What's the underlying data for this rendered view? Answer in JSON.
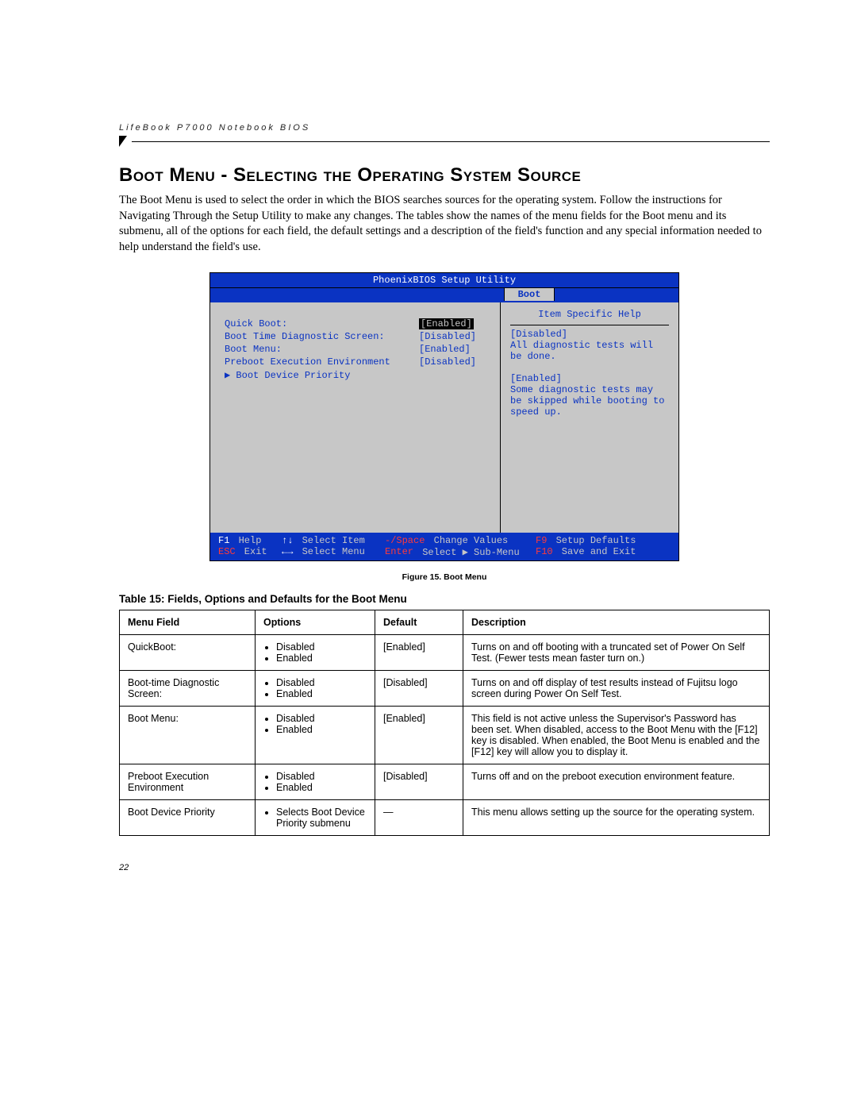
{
  "running_head": "LifeBook P7000 Notebook BIOS",
  "section_title": "Boot Menu - Selecting the Operating System Source",
  "intro_text": "The Boot Menu is used to select the order in which the BIOS searches sources for the operating system. Follow the instructions for Navigating Through the Setup Utility to make any changes. The tables show the names of the menu fields for the Boot menu and its submenu, all of the options for each field, the default settings and a description of the field's function and any special information needed to help understand the field's use.",
  "bios": {
    "utility_title": "PhoenixBIOS Setup Utility",
    "active_tab": "Boot",
    "items": [
      {
        "label": "Quick Boot:",
        "value": "[Enabled]",
        "selected": true
      },
      {
        "label": "Boot Time Diagnostic Screen:",
        "value": "[Disabled]",
        "selected": false
      },
      {
        "label": "Boot Menu:",
        "value": "[Enabled]",
        "selected": false
      },
      {
        "label": "Preboot Execution Environment",
        "value": "[Disabled]",
        "selected": false
      },
      {
        "label": "▶ Boot Device Priority",
        "value": "",
        "selected": false
      }
    ],
    "help": {
      "heading": "Item Specific Help",
      "blocks": [
        "[Disabled]",
        "All diagnostic tests will be done.",
        "",
        "[Enabled]",
        "Some diagnostic tests may be skipped while booting to speed up."
      ]
    },
    "footer": {
      "row1": [
        {
          "key": "F1",
          "text": "Help"
        },
        {
          "key": "↑↓",
          "text": "Select Item"
        },
        {
          "key": "-/Space",
          "text": "Change Values",
          "red": true
        },
        {
          "key": "F9",
          "text": "Setup Defaults",
          "red": true
        }
      ],
      "row2": [
        {
          "key": "ESC",
          "text": "Exit",
          "red": true
        },
        {
          "key": "←→",
          "text": "Select Menu"
        },
        {
          "key": "Enter",
          "text": "Select ▶ Sub-Menu",
          "red": true
        },
        {
          "key": "F10",
          "text": "Save and Exit",
          "red": true
        }
      ]
    }
  },
  "figure_caption": "Figure 15.  Boot Menu",
  "table_caption": "Table 15: Fields, Options and Defaults for the Boot Menu",
  "table_headers": [
    "Menu Field",
    "Options",
    "Default",
    "Description"
  ],
  "table_rows": [
    {
      "field": "QuickBoot:",
      "options": [
        "Disabled",
        "Enabled"
      ],
      "default": "[Enabled]",
      "description": "Turns on and off booting with a truncated set of Power On Self Test. (Fewer tests mean faster turn on.)"
    },
    {
      "field": "Boot-time Diagnostic Screen:",
      "options": [
        "Disabled",
        "Enabled"
      ],
      "default": "[Disabled]",
      "description": "Turns on and off display of test results instead of Fujitsu logo screen during Power On Self Test."
    },
    {
      "field": "Boot Menu:",
      "options": [
        "Disabled",
        "Enabled"
      ],
      "default": "[Enabled]",
      "description": "This field is not active unless the Supervisor's Password has been set. When disabled, access to the Boot Menu with the [F12] key is disabled. When enabled, the Boot Menu is enabled and the [F12] key will allow you to display it."
    },
    {
      "field": "Preboot Execution Environment",
      "options": [
        "Disabled",
        "Enabled"
      ],
      "default": "[Disabled]",
      "description": "Turns off and on the preboot execution environment feature."
    },
    {
      "field": "Boot Device Priority",
      "options": [
        "Selects Boot Device Priority submenu"
      ],
      "default": "—",
      "description": "This menu allows setting up the source for the operating system."
    }
  ],
  "page_number": "22"
}
